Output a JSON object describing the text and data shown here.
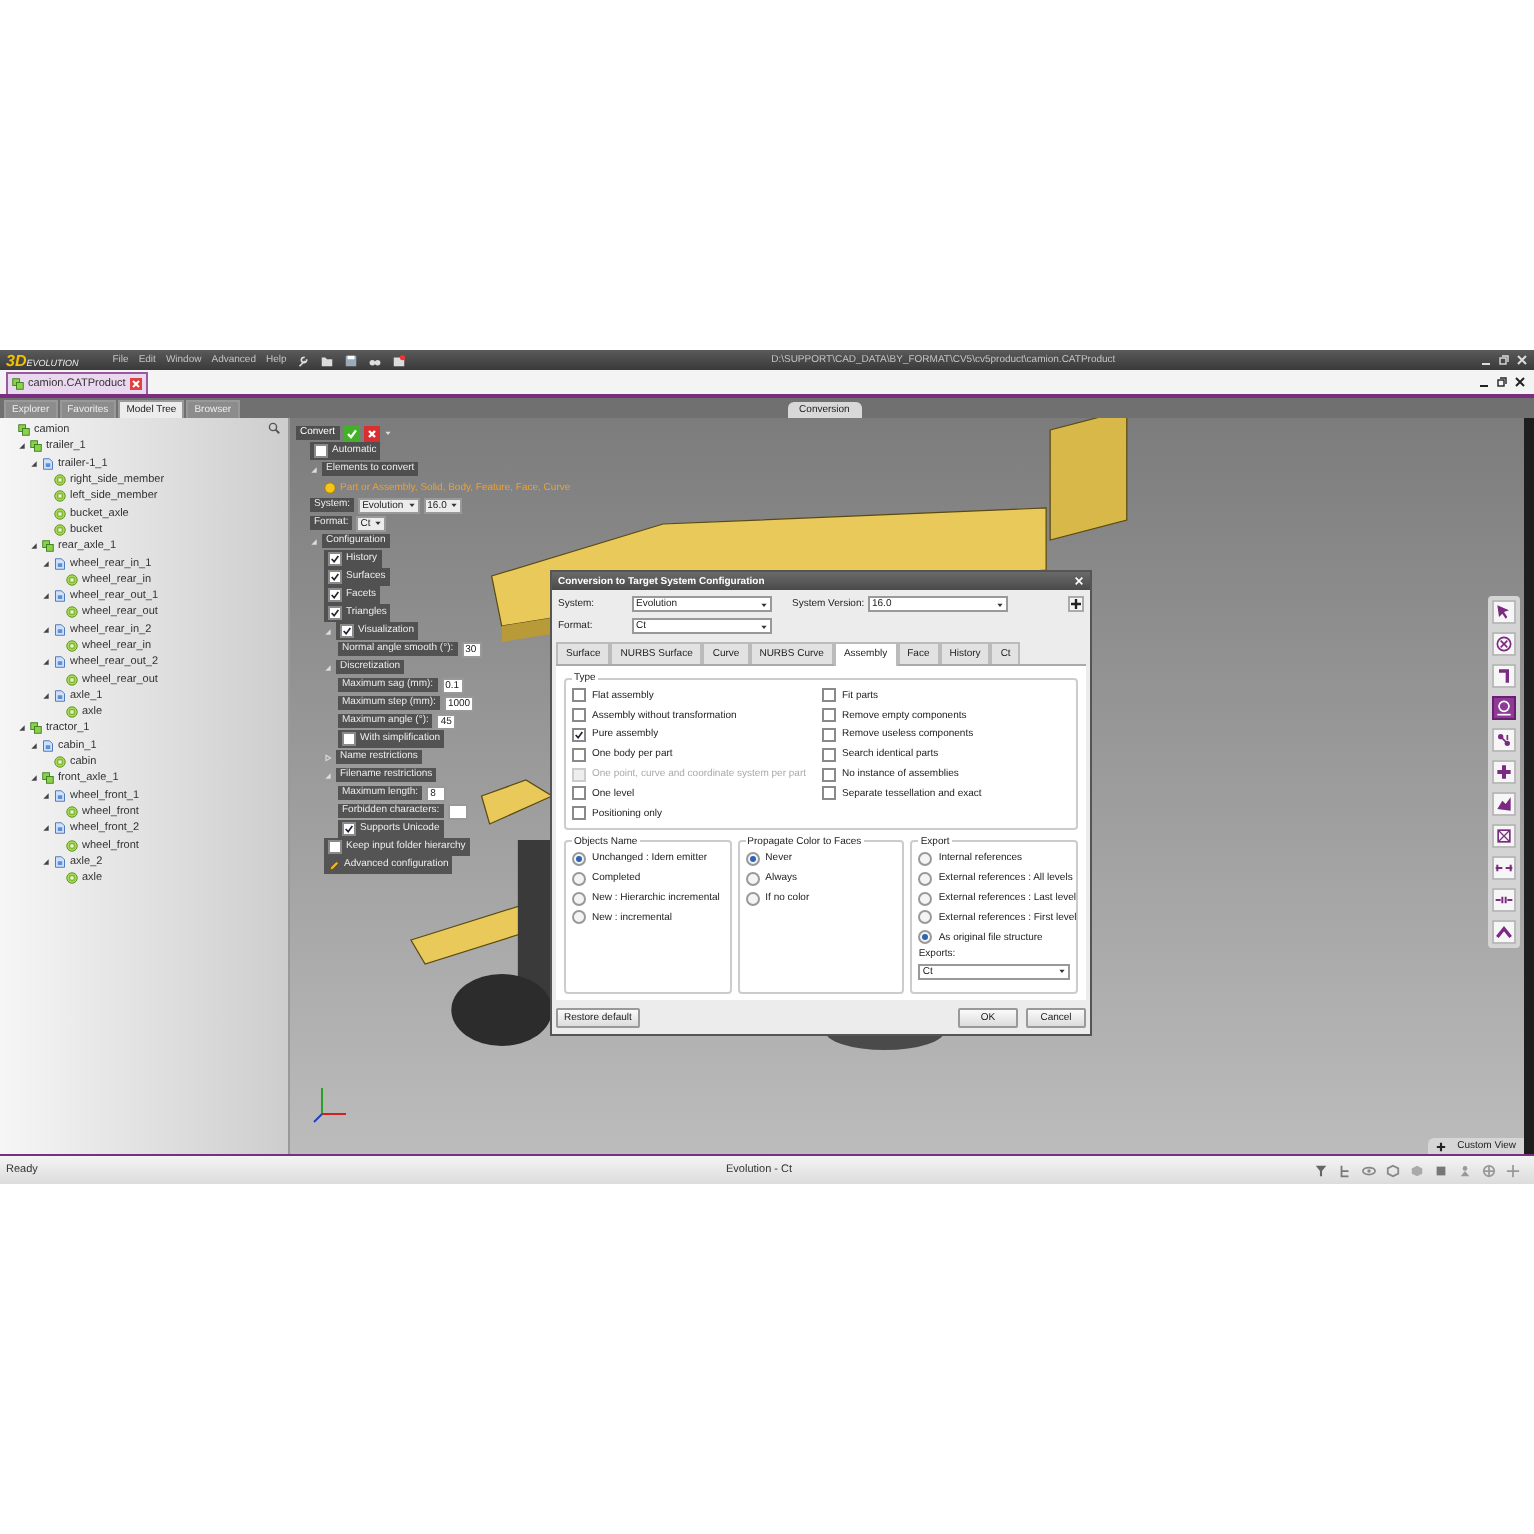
{
  "app": {
    "logo": "3D",
    "logo_sub": "EVOLUTION",
    "menu": [
      "File",
      "Edit",
      "Window",
      "Advanced",
      "Help"
    ],
    "path": "D:\\SUPPORT\\CAD_DATA\\BY_FORMAT\\CV5\\cv5product\\camion.CATProduct"
  },
  "document_tabs": [
    {
      "label": "camion.CATProduct",
      "selected": true
    }
  ],
  "panel_tabs": [
    {
      "label": "Explorer",
      "selected": false
    },
    {
      "label": "Favorites",
      "selected": false
    },
    {
      "label": "Model Tree",
      "selected": true
    },
    {
      "label": "Browser",
      "selected": false
    }
  ],
  "view_tab": "Conversion",
  "model_tree": [
    {
      "label": "camion",
      "kind": "product",
      "children": [
        {
          "label": "trailer_1",
          "kind": "product",
          "expanded": true,
          "children": [
            {
              "label": "trailer-1_1",
              "kind": "component",
              "expanded": true,
              "children": [
                {
                  "label": "right_side_member",
                  "kind": "part"
                },
                {
                  "label": "left_side_member",
                  "kind": "part"
                },
                {
                  "label": "bucket_axle",
                  "kind": "part"
                },
                {
                  "label": "bucket",
                  "kind": "part"
                }
              ]
            },
            {
              "label": "rear_axle_1",
              "kind": "product",
              "expanded": true,
              "children": [
                {
                  "label": "wheel_rear_in_1",
                  "kind": "component",
                  "expanded": true,
                  "children": [
                    {
                      "label": "wheel_rear_in",
                      "kind": "part"
                    }
                  ]
                },
                {
                  "label": "wheel_rear_out_1",
                  "kind": "component",
                  "expanded": true,
                  "children": [
                    {
                      "label": "wheel_rear_out",
                      "kind": "part"
                    }
                  ]
                },
                {
                  "label": "wheel_rear_in_2",
                  "kind": "component",
                  "expanded": true,
                  "children": [
                    {
                      "label": "wheel_rear_in",
                      "kind": "part"
                    }
                  ]
                },
                {
                  "label": "wheel_rear_out_2",
                  "kind": "component",
                  "expanded": true,
                  "children": [
                    {
                      "label": "wheel_rear_out",
                      "kind": "part"
                    }
                  ]
                },
                {
                  "label": "axle_1",
                  "kind": "component",
                  "expanded": true,
                  "children": [
                    {
                      "label": "axle",
                      "kind": "part"
                    }
                  ]
                }
              ]
            }
          ]
        },
        {
          "label": "tractor_1",
          "kind": "product",
          "expanded": true,
          "children": [
            {
              "label": "cabin_1",
              "kind": "component",
              "expanded": true,
              "children": [
                {
                  "label": "cabin",
                  "kind": "part"
                }
              ]
            },
            {
              "label": "front_axle_1",
              "kind": "product",
              "expanded": true,
              "children": [
                {
                  "label": "wheel_front_1",
                  "kind": "component",
                  "expanded": true,
                  "children": [
                    {
                      "label": "wheel_front",
                      "kind": "part"
                    }
                  ]
                },
                {
                  "label": "wheel_front_2",
                  "kind": "component",
                  "expanded": true,
                  "children": [
                    {
                      "label": "wheel_front",
                      "kind": "part"
                    }
                  ]
                },
                {
                  "label": "axle_2",
                  "kind": "component",
                  "expanded": true,
                  "children": [
                    {
                      "label": "axle",
                      "kind": "part"
                    }
                  ]
                }
              ]
            }
          ]
        }
      ]
    }
  ],
  "config_panel": {
    "title": "Convert",
    "rows": [
      {
        "kind": "checkbox",
        "label": "Automatic",
        "checked": false
      },
      {
        "kind": "section",
        "label": "Elements to convert",
        "expanded": true,
        "children": [
          {
            "kind": "link",
            "label": "Part or Assembly, Solid, Body, Feature, Face, Curve"
          }
        ]
      },
      {
        "kind": "select",
        "label": "System:",
        "values": [
          "Evolution",
          "16.0"
        ]
      },
      {
        "kind": "select",
        "label": "Format:",
        "values": [
          "Ct"
        ]
      },
      {
        "kind": "section",
        "label": "Configuration",
        "expanded": true,
        "children": [
          {
            "kind": "checkbox",
            "label": "History",
            "checked": true
          },
          {
            "kind": "checkbox",
            "label": "Surfaces",
            "checked": true
          },
          {
            "kind": "checkbox",
            "label": "Facets",
            "checked": true
          },
          {
            "kind": "checkbox",
            "label": "Triangles",
            "checked": true
          },
          {
            "kind": "checkbox",
            "label": "Visualization",
            "checked": true,
            "expanded": true,
            "children": [
              {
                "kind": "field",
                "label": "Normal angle smooth (°):",
                "value": "30"
              }
            ]
          },
          {
            "kind": "section",
            "label": "Discretization",
            "expanded": true,
            "children": [
              {
                "kind": "field",
                "label": "Maximum sag (mm):",
                "value": "0.1"
              },
              {
                "kind": "field",
                "label": "Maximum step (mm):",
                "value": "1000"
              },
              {
                "kind": "field",
                "label": "Maximum angle (°):",
                "value": "45"
              },
              {
                "kind": "checkbox",
                "label": "With simplification",
                "checked": false
              }
            ]
          },
          {
            "kind": "section",
            "label": "Name restrictions",
            "expanded": false
          },
          {
            "kind": "section",
            "label": "Filename restrictions",
            "expanded": true,
            "children": [
              {
                "kind": "field",
                "label": "Maximum length:",
                "value": "8"
              },
              {
                "kind": "field",
                "label": "Forbidden characters:"
              },
              {
                "kind": "checkbox",
                "label": "Supports Unicode",
                "checked": true
              }
            ]
          },
          {
            "kind": "checkbox",
            "label": "Keep input folder hierarchy",
            "checked": false
          },
          {
            "kind": "action",
            "label": "Advanced configuration"
          }
        ]
      }
    ]
  },
  "dialog": {
    "title": "Conversion to Target System Configuration",
    "system_label": "System:",
    "system": "Evolution",
    "version_label": "System Version:",
    "version": "16.0",
    "format_label": "Format:",
    "format": "Ct",
    "tabs": [
      {
        "label": "Surface",
        "selected": false
      },
      {
        "label": "NURBS Surface",
        "selected": false
      },
      {
        "label": "Curve",
        "selected": false
      },
      {
        "label": "NURBS Curve",
        "selected": false
      },
      {
        "label": "Assembly",
        "selected": true
      },
      {
        "label": "Face",
        "selected": false
      },
      {
        "label": "History",
        "selected": false
      },
      {
        "label": "Ct",
        "selected": false
      }
    ],
    "type": {
      "title": "Type",
      "columns": [
        [
          {
            "label": "Flat assembly",
            "checked": false,
            "disabled": false
          },
          {
            "label": "Assembly without transformation",
            "checked": false,
            "disabled": false
          },
          {
            "label": "Pure assembly",
            "checked": true,
            "disabled": false
          },
          {
            "label": "One body per part",
            "checked": false,
            "disabled": false
          },
          {
            "label": "One point, curve and coordinate system per part",
            "checked": false,
            "disabled": true
          },
          {
            "label": "One level",
            "checked": false,
            "disabled": false
          },
          {
            "label": "Positioning only",
            "checked": false,
            "disabled": false
          }
        ],
        [
          {
            "label": "Fit parts",
            "checked": false,
            "disabled": false
          },
          {
            "label": "Remove empty components",
            "checked": false,
            "disabled": false
          },
          {
            "label": "Remove useless components",
            "checked": false,
            "disabled": false
          },
          {
            "label": "Search identical parts",
            "checked": false,
            "disabled": false
          },
          {
            "label": "No instance of assemblies",
            "checked": false,
            "disabled": false
          },
          {
            "label": "Separate tessellation and exact",
            "checked": false,
            "disabled": false
          }
        ]
      ]
    },
    "objects_name": {
      "title": "Objects Name",
      "options": [
        {
          "label": "Unchanged : Idem emitter",
          "selected": true
        },
        {
          "label": "Completed",
          "selected": false
        },
        {
          "label": "New : Hierarchic incremental",
          "selected": false
        },
        {
          "label": "New : incremental",
          "selected": false
        }
      ]
    },
    "propagate_color": {
      "title": "Propagate Color to Faces",
      "options": [
        {
          "label": "Never",
          "selected": true
        },
        {
          "label": "Always",
          "selected": false
        },
        {
          "label": "If no color",
          "selected": false
        }
      ]
    },
    "export": {
      "title": "Export",
      "options": [
        {
          "label": "Internal references",
          "selected": false
        },
        {
          "label": "External references : All levels",
          "selected": false
        },
        {
          "label": "External references : Last level",
          "selected": false
        },
        {
          "label": "External references : First level",
          "selected": false
        },
        {
          "label": "As original file structure",
          "selected": true
        }
      ],
      "exports_label": "Exports:",
      "exports": "Ct"
    },
    "buttons": {
      "restore": "Restore default",
      "ok": "OK",
      "cancel": "Cancel"
    }
  },
  "view_tools": [
    {
      "selected": false
    },
    {
      "selected": false
    },
    {
      "selected": false
    },
    {
      "selected": true
    },
    {
      "selected": false
    },
    {
      "selected": false
    },
    {
      "selected": false
    },
    {
      "selected": false
    },
    {
      "selected": false
    },
    {
      "selected": false
    },
    {
      "selected": false
    }
  ],
  "custom_view": "Custom View",
  "status_bar": {
    "left": "Ready",
    "center": "Evolution - Ct"
  }
}
